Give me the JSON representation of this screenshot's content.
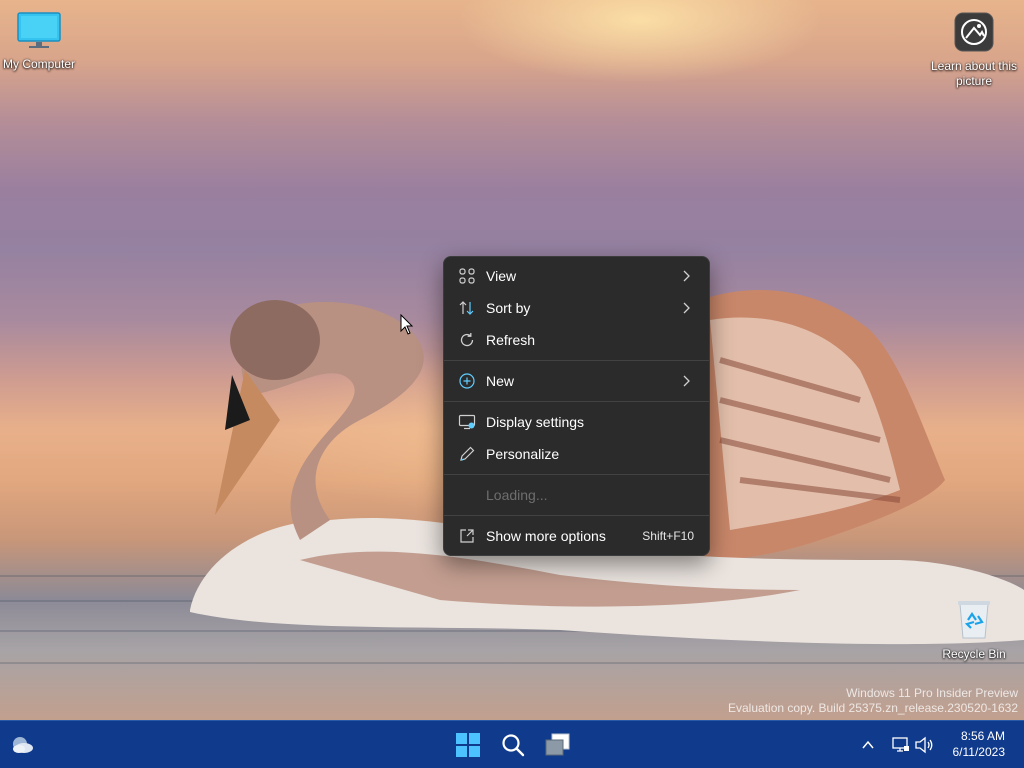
{
  "desktop": {
    "icons": [
      {
        "label": "My Computer"
      },
      {
        "label": "Learn about this picture"
      },
      {
        "label": "Recycle Bin"
      }
    ],
    "watermark": {
      "line1": "Windows 11 Pro Insider Preview",
      "line2": "Evaluation copy. Build 25375.zn_release.230520-1632"
    }
  },
  "context_menu": {
    "items": [
      {
        "label": "View",
        "icon": "view-grid-icon",
        "submenu": true
      },
      {
        "label": "Sort by",
        "icon": "sort-icon",
        "submenu": true
      },
      {
        "label": "Refresh",
        "icon": "refresh-icon",
        "submenu": false
      },
      {
        "label": "New",
        "icon": "plus-circle-icon",
        "submenu": true
      },
      {
        "label": "Display settings",
        "icon": "display-settings-icon",
        "submenu": false
      },
      {
        "label": "Personalize",
        "icon": "pen-icon",
        "submenu": false
      },
      {
        "label": "Loading...",
        "icon": "",
        "submenu": false,
        "disabled": true
      },
      {
        "label": "Show more options",
        "icon": "open-external-icon",
        "shortcut": "Shift+F10"
      }
    ]
  },
  "taskbar": {
    "buttons": [
      "weather-icon",
      "start-icon",
      "search-icon",
      "task-view-icon"
    ],
    "tray": {
      "icons": [
        "show-hidden-icons-chevron",
        "network-icon",
        "volume-icon"
      ],
      "time": "8:56 AM",
      "date": "6/11/2023"
    }
  },
  "colors": {
    "menu_bg": "#2b2b2b",
    "taskbar_bg": "#103a8c",
    "accent_icon": "#60cdff"
  }
}
